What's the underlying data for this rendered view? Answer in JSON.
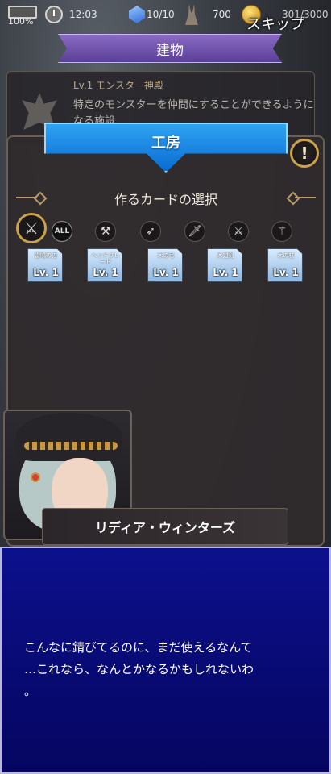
{
  "status": {
    "battery": "100%",
    "time": "12:03",
    "gems": "10/10",
    "rabbit": "700",
    "coins": "301/3000"
  },
  "skip_label": "スキップ",
  "top_banner": "建物",
  "building": {
    "title": "Lv.1 モンスター神殿",
    "description": "特定のモンスターを仲間にすることができるようになる施設"
  },
  "workshop": {
    "title": "工房",
    "help": "!",
    "section_title": "作るカードの選択"
  },
  "filters": [
    {
      "icon": "crossed-swords-icon",
      "label": "⚔"
    },
    {
      "icon": "all-icon",
      "label": "ALL"
    },
    {
      "icon": "axe-icon",
      "label": "⚒"
    },
    {
      "icon": "bow-icon",
      "label": "➶"
    },
    {
      "icon": "dagger-icon",
      "label": "🗡"
    },
    {
      "icon": "sword-icon",
      "label": "⚔"
    },
    {
      "icon": "staff-icon",
      "label": "⚚"
    }
  ],
  "cards": [
    {
      "name": "雷鳴の刃",
      "level": "Lv. 1"
    },
    {
      "name": "ヘッドブレード",
      "level": "Lv. 1"
    },
    {
      "name": "木の弓",
      "level": "Lv. 1"
    },
    {
      "name": "木刀剣",
      "level": "Lv. 1"
    },
    {
      "name": "木の杖",
      "level": "Lv. 1"
    }
  ],
  "dialogue": {
    "speaker": "リディア・ウィンターズ",
    "text": "こんなに錆びてるのに、まだ使えるなんて\n…これなら、なんとかなるかもしれないわ\n。"
  }
}
